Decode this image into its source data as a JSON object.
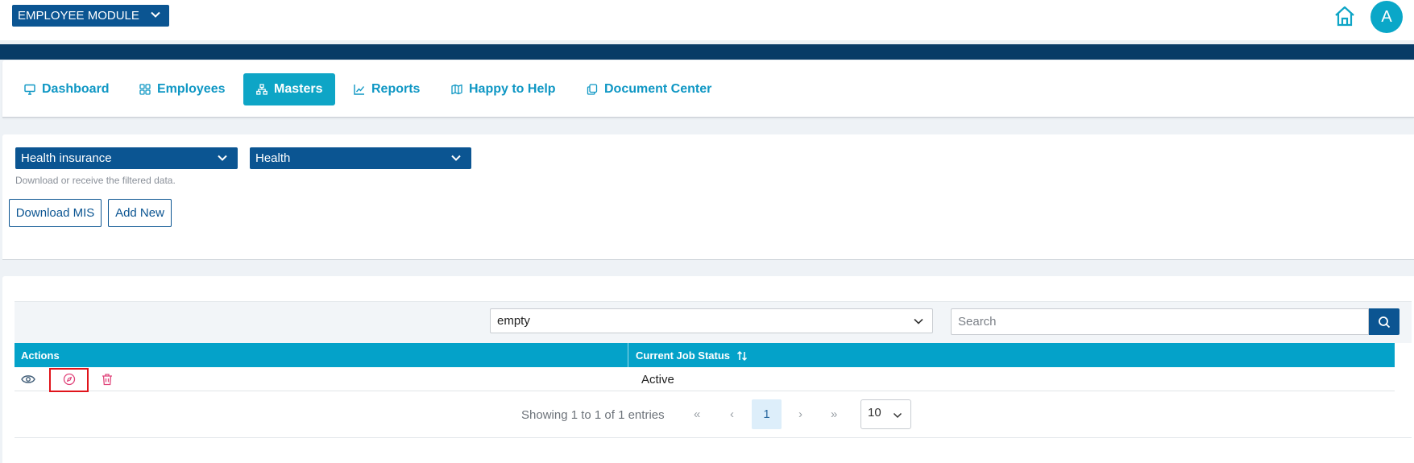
{
  "header": {
    "module_select": "EMPLOYEE MODULE",
    "avatar_initial": "A"
  },
  "nav": {
    "items": [
      {
        "label": "Dashboard",
        "icon": "monitor-icon"
      },
      {
        "label": "Employees",
        "icon": "grid-icon"
      },
      {
        "label": "Masters",
        "icon": "sitemap-icon",
        "active": true
      },
      {
        "label": "Reports",
        "icon": "line-chart-icon"
      },
      {
        "label": "Happy to Help",
        "icon": "map-icon"
      },
      {
        "label": "Document Center",
        "icon": "copy-icon"
      }
    ]
  },
  "filters": {
    "category": "Health insurance",
    "type": "Health",
    "hint": "Download or receive the filtered data.",
    "download_label": "Download MIS",
    "add_label": "Add New"
  },
  "table": {
    "column_filter": "empty",
    "search_placeholder": "Search",
    "columns": [
      "Actions",
      "Current Job Status"
    ],
    "rows": [
      {
        "current_job_status": "Active"
      }
    ]
  },
  "pagination": {
    "info": "Showing 1 to 1 of 1 entries",
    "first": "«",
    "prev": "‹",
    "current_page": "1",
    "next": "›",
    "last": "»",
    "per_page": "10"
  },
  "colors": {
    "navy": "#0b5592",
    "accent": "#0ea5c6",
    "header_teal": "#04a2c9",
    "highlight_red": "#e0141b",
    "delete_pink": "#e0457b"
  }
}
